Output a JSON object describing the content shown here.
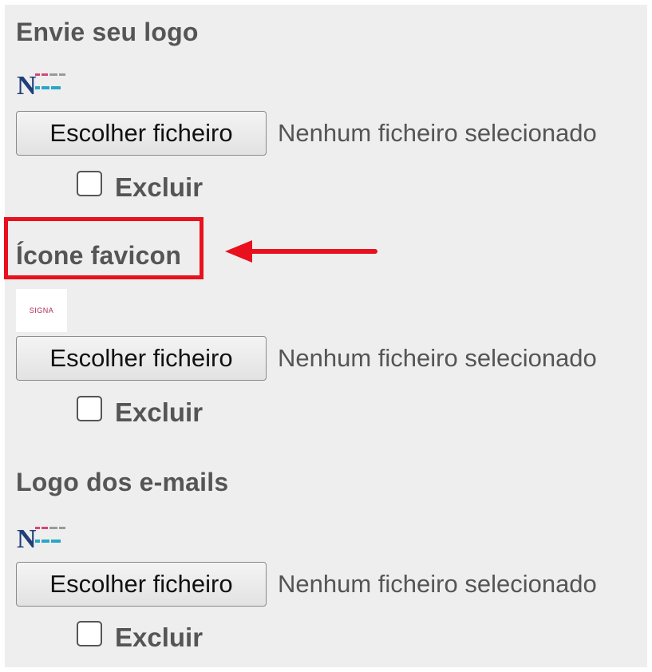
{
  "sections": [
    {
      "title": "Envie seu logo",
      "button_label": "Escolher ficheiro",
      "status": "Nenhum ficheiro selecionado",
      "checkbox_label": "Excluir"
    },
    {
      "title": "Ícone favicon",
      "thumb_text": "SIGNA",
      "button_label": "Escolher ficheiro",
      "status": "Nenhum ficheiro selecionado",
      "checkbox_label": "Excluir"
    },
    {
      "title": "Logo dos e-mails",
      "button_label": "Escolher ficheiro",
      "status": "Nenhum ficheiro selecionado",
      "checkbox_label": "Excluir"
    }
  ],
  "annotation": {
    "highlight_color": "#e8111d",
    "arrow_color": "#e8111d",
    "target": "Ícone favicon"
  }
}
